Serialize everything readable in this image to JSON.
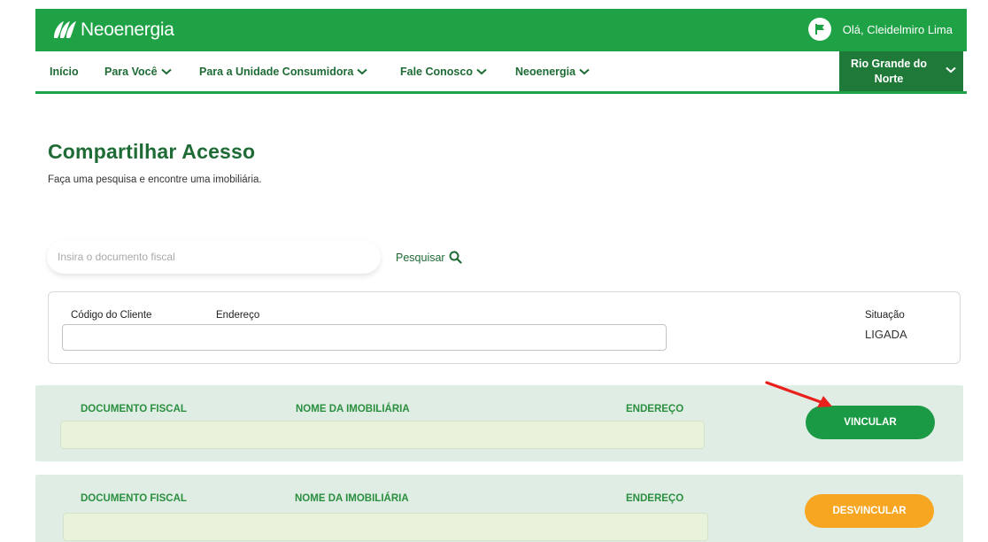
{
  "header": {
    "brand": "Neoenergia",
    "greeting": "Olá, Cleidelmiro Lima",
    "brand_color": "#1fa246",
    "icons": {
      "logo": "leaf-logo-icon",
      "user": "flag-icon"
    }
  },
  "nav": {
    "items": [
      {
        "label": "Início",
        "has_dropdown": false
      },
      {
        "label": "Para Você",
        "has_dropdown": true
      },
      {
        "label": "Para a Unidade Consumidora",
        "has_dropdown": true
      },
      {
        "label": "Fale Conosco",
        "has_dropdown": true
      },
      {
        "label": "Neoenergia",
        "has_dropdown": true
      }
    ],
    "region_line1": "Rio Grande do",
    "region_line2": "Norte",
    "region_color": "#1f7a3a"
  },
  "page": {
    "title": "Compartilhar Acesso",
    "subtitle": "Faça uma pesquisa e encontre uma imobiliária."
  },
  "search": {
    "placeholder": "Insira o documento fiscal",
    "value": "",
    "button_label": "Pesquisar",
    "icon": "search-icon"
  },
  "client": {
    "code_label": "Código do Cliente",
    "address_label": "Endereço",
    "status_label": "Situação",
    "status_value": "LIGADA"
  },
  "results": {
    "col_document": "DOCUMENTO FISCAL",
    "col_name": "NOME DA IMOBILIÁRIA",
    "col_address": "ENDEREÇO",
    "rows": [
      {
        "action_label": "VINCULAR",
        "action_color": "#1a9a45"
      },
      {
        "action_label": "DESVINCULAR",
        "action_color": "#f7a621"
      }
    ]
  },
  "annotation": {
    "arrow_color": "#e8211c",
    "icon": "red-arrow-icon"
  }
}
